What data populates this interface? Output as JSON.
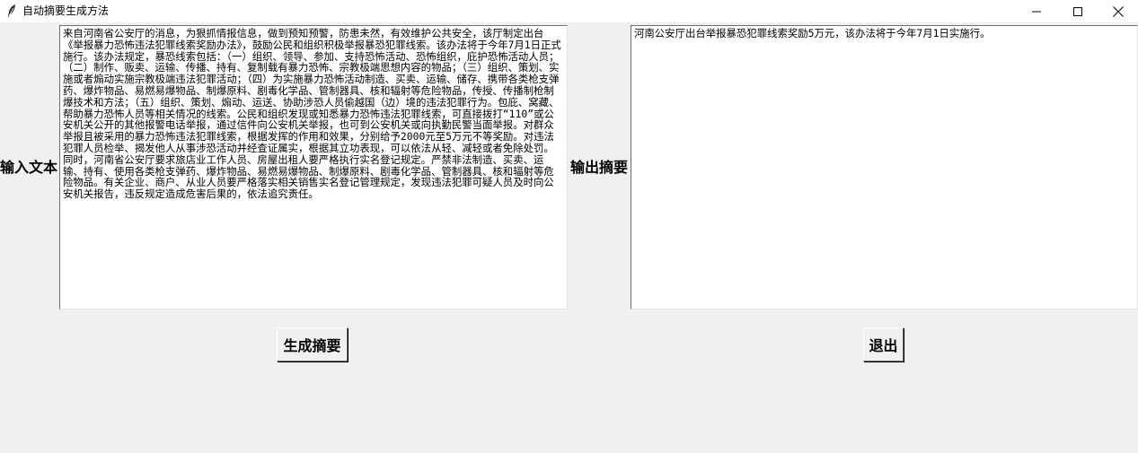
{
  "window": {
    "title": "自动摘要生成方法"
  },
  "input": {
    "label": "输入文本",
    "text": "来自河南省公安厅的消息，为狠抓情报信息，做到预知预警，防患未然，有效维护公共安全，该厅制定出台《举报暴力恐怖违法犯罪线索奖励办法》，鼓励公民和组织积极举报暴恐犯罪线索。该办法将于今年7月1日正式施行。该办法规定，暴恐线索包括：（一）组织、领导、参加、支持恐怖活动、恐怖组织，庇护恐怖活动人员；（二）制作、贩卖、运输、传播、持有、复制载有暴力恐怖、宗教极端思想内容的物品；（三）组织、策划、实施或者煽动实施宗教极端违法犯罪活动；（四）为实施暴力恐怖活动制造、买卖、运输、储存、携带各类枪支弹药、爆炸物品、易燃易爆物品、制爆原料、剧毒化学品、管制器具、核和辐射等危险物品，传授、传播制枪制爆技术和方法；（五）组织、策划、煽动、运送、协助涉恐人员偷越国（边）境的违法犯罪行为。包庇、窝藏、帮助暴力恐怖人员等相关情况的线索。公民和组织发现或知悉暴力恐怖违法犯罪线索，可直接拨打“110”或公安机关公开的其他报警电话举报，通过信件向公安机关举报，也可到公安机关或向执勤民警当面举报。对群众举报且被采用的暴力恐怖违法犯罪线索，根据发挥的作用和效果，分别给予2000元至5万元不等奖励。对违法犯罪人员检举、揭发他人从事涉恐活动并经查证属实，根据其立功表现，可以依法从轻、减轻或者免除处罚。同时，河南省公安厅要求旅店业工作人员、房屋出租人要严格执行实名登记规定。严禁非法制造、买卖、运输、持有、使用各类枪支弹药、爆炸物品、易燃易爆物品、制爆原料、剧毒化学品、管制器具、核和辐射等危险物品。有关企业、商户、从业人员要严格落实相关销售实名登记管理规定，发现违法犯罪可疑人员及时向公安机关报告，违反规定造成危害后果的，依法追究责任。"
  },
  "output": {
    "label": "输出摘要",
    "text": "河南公安厅出台举报暴恐犯罪线索奖励5万元，该办法将于今年7月1日实施行。"
  },
  "buttons": {
    "generate": "生成摘要",
    "exit": "退出"
  },
  "icons": {
    "app": "feather-icon",
    "minimize": "minimize-icon",
    "maximize": "maximize-icon",
    "close": "close-icon"
  }
}
